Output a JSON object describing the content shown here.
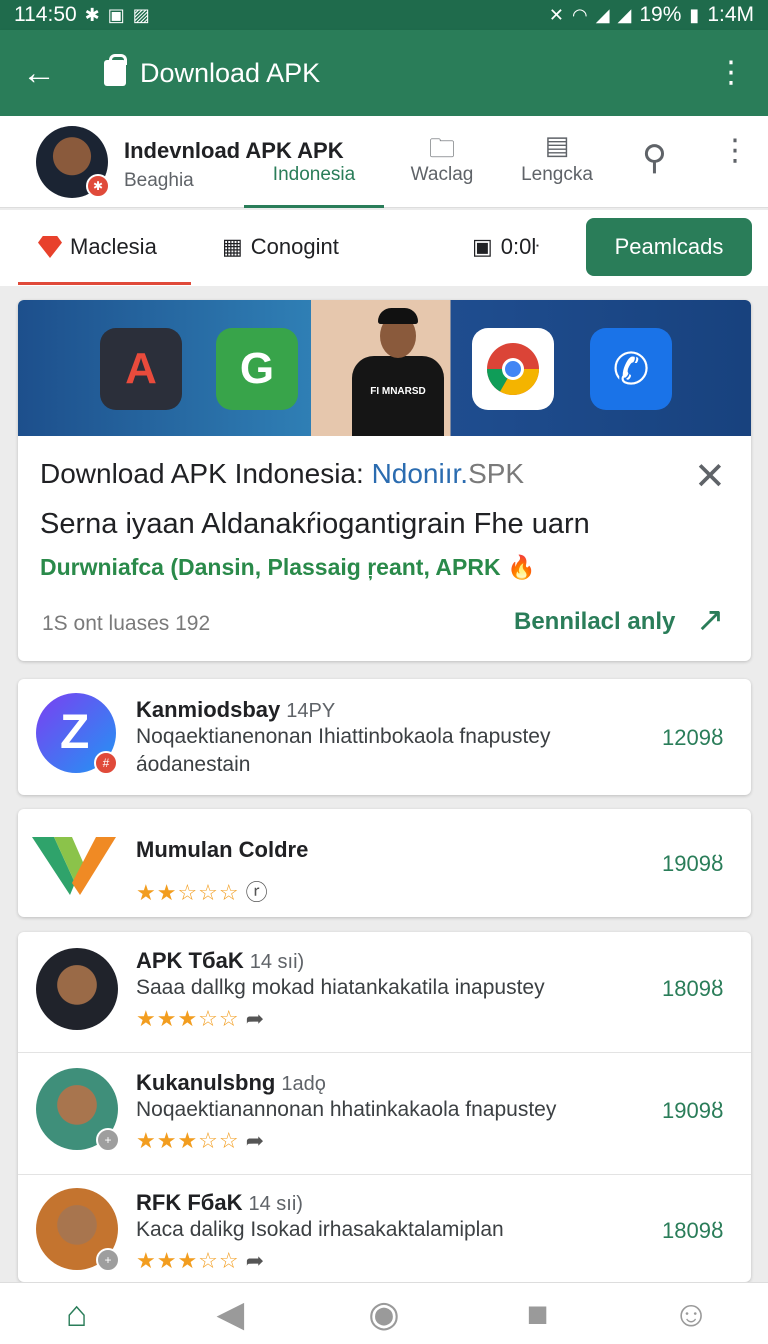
{
  "status_bar": {
    "time_left": "114:50",
    "battery": "19%",
    "time_right": "1:4M"
  },
  "app_bar": {
    "title": "Download APK"
  },
  "profile": {
    "name": "Indevnload APK APK",
    "subtitle": "Beaghia"
  },
  "top_tabs": [
    {
      "label": "Indonesia",
      "icon": "none",
      "active": true
    },
    {
      "label": "Waclag",
      "icon": "briefcase-icon"
    },
    {
      "label": "Lengcka",
      "icon": "grid-icon"
    }
  ],
  "filters": [
    {
      "label": "Maclesia",
      "icon": "diamond-icon",
      "active": true
    },
    {
      "label": "Conogint",
      "icon": "calculator-icon"
    },
    {
      "label": "0:0ŀ",
      "icon": "calendar-icon"
    }
  ],
  "filter_button": "Peamlcads",
  "hero": {
    "banner_apps": [
      "A",
      "G",
      "Chrome",
      "Phone"
    ],
    "person_shirt": "FI MNARSD",
    "title_main": "Download APK Indonesia: ",
    "title_highlight": "Ndoniır.",
    "title_highlight2": "SPK",
    "line2": "Serna iyaan Aldanakŕiogantigrain Fhe uarn",
    "line3": "Durwniafca (Dansin, Plassaig ŗeant, APRK",
    "meta": "1S ont luases 192",
    "action": "Bennilacl anly"
  },
  "rows": [
    {
      "name": "Kanmiodsbay",
      "extra": "14PY",
      "desc": "Noqaektianenonan Ihiattinbokaola fnapustey",
      "desc2": "áodanestain",
      "pct": "1209ȣ",
      "stars": ""
    },
    {
      "name": "Mumulan Coldre",
      "extra": "",
      "desc": "",
      "desc2": "",
      "pct": "1909ȣ",
      "stars": "★★☆☆☆"
    },
    {
      "name": "APK TбaK",
      "extra": "14 sıi)",
      "desc": "Saaa dallkg mokad hiatankakatila inapustey",
      "desc2": "",
      "pct": "1809ȣ",
      "stars": "★★★☆☆"
    },
    {
      "name": "Kukanulsbng",
      "extra": "1adǫ",
      "desc": "Noqaektianannonan hhatinkakaola fnapustey",
      "desc2": "",
      "pct": "1909ȣ",
      "stars": "★★★☆☆"
    },
    {
      "name": "RFK FбaK",
      "extra": "14 sıi)",
      "desc": "Kaca dalikg Isokad irhasakaktalamiplan",
      "desc2": "",
      "pct": "1809ȣ",
      "stars": "★★★☆☆"
    }
  ],
  "colors": {
    "primary": "#2a7d59",
    "status": "#1f6b4c",
    "accent_red": "#e04a3a",
    "star": "#f29d1f"
  }
}
